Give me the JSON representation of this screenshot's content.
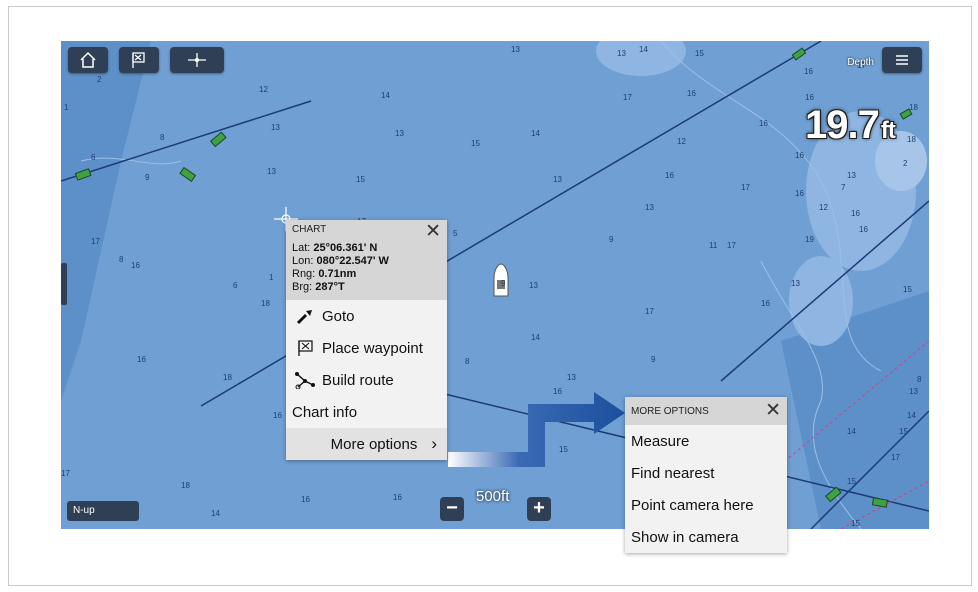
{
  "toolbar": {
    "home_icon": "home-icon",
    "waypoint_icon": "waypoint-flag-icon",
    "cursor_icon": "cursor-crosshair-icon",
    "menu_icon": "hamburger-menu-icon"
  },
  "depth": {
    "label": "Depth",
    "value": "19.7",
    "unit": "ft"
  },
  "orientation": "N-up",
  "scale": {
    "label": "500ft",
    "zoom_out": "−",
    "zoom_in": "+"
  },
  "soundings": [
    "2",
    "13",
    "13",
    "14",
    "15",
    "17",
    "16",
    "18",
    "1",
    "8",
    "12",
    "13",
    "14",
    "13",
    "15",
    "17",
    "16",
    "16",
    "18",
    "6",
    "9",
    "13",
    "15",
    "14",
    "13",
    "12",
    "16",
    "2",
    "17",
    "16",
    "13",
    "12",
    "13",
    "16",
    "17",
    "16",
    "5",
    "9",
    "11",
    "17",
    "19",
    "16",
    "6",
    "1",
    "9",
    "13",
    "13",
    "15",
    "16",
    "17",
    "16",
    "8",
    "9",
    "18",
    "13",
    "16",
    "16",
    "14",
    "15",
    "15",
    "17",
    "16",
    "16",
    "14",
    "14",
    "15",
    "15",
    "17",
    "18",
    "18",
    "13",
    "11",
    "14",
    "17",
    "16",
    "16",
    "7",
    "8",
    "13",
    "14",
    "8"
  ],
  "context_menu": {
    "title": "CHART",
    "lat_label": "Lat:",
    "lat": "25°06.361' N",
    "lon_label": "Lon:",
    "lon": "080°22.547' W",
    "rng_label": "Rng:",
    "rng": "0.71nm",
    "brg_label": "Brg:",
    "brg": "287°T",
    "items": [
      {
        "label": "Goto",
        "icon": "goto-icon"
      },
      {
        "label": "Place waypoint",
        "icon": "place-waypoint-icon"
      },
      {
        "label": "Build route",
        "icon": "build-route-icon"
      },
      {
        "label": "Chart info",
        "icon": ""
      }
    ],
    "more_label": "More options"
  },
  "more_options": {
    "title": "MORE OPTIONS",
    "items": [
      "Measure",
      "Find nearest",
      "Point camera here",
      "Show in camera"
    ]
  },
  "colors": {
    "water": "#6f9fd3",
    "shallow": "#8fb6e2",
    "panel": "#f2f2f2",
    "panel_header": "#d6d6d6",
    "accent": "#1b4f9c"
  }
}
